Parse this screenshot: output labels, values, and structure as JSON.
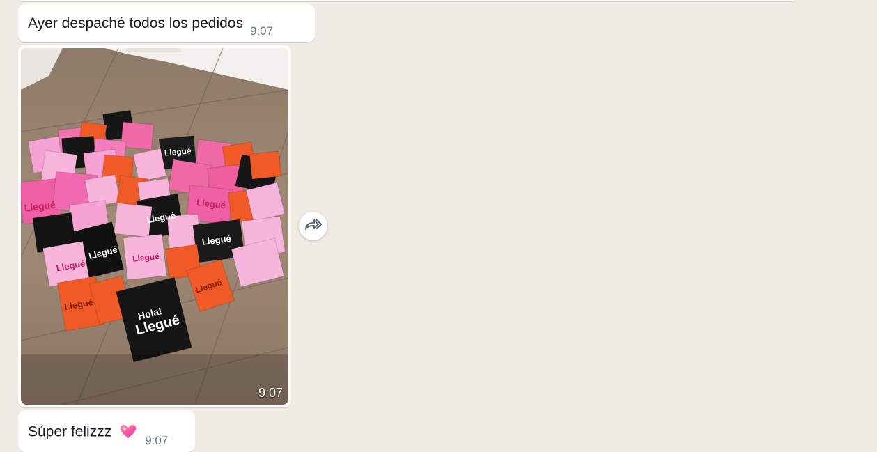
{
  "messages": [
    {
      "text": "Ayer despaché todos los pedidos",
      "time": "9:07"
    },
    {
      "type": "image",
      "image_label": "Hola! Llegué",
      "time": "9:07"
    },
    {
      "text": "Súper felizzz",
      "emoji": "sparkling-heart",
      "time": "9:07"
    }
  ],
  "forward_icon": "forward-icon",
  "colors": {
    "chat_background": "#efeae2",
    "bubble": "#ffffff",
    "timestamp": "#667781"
  }
}
